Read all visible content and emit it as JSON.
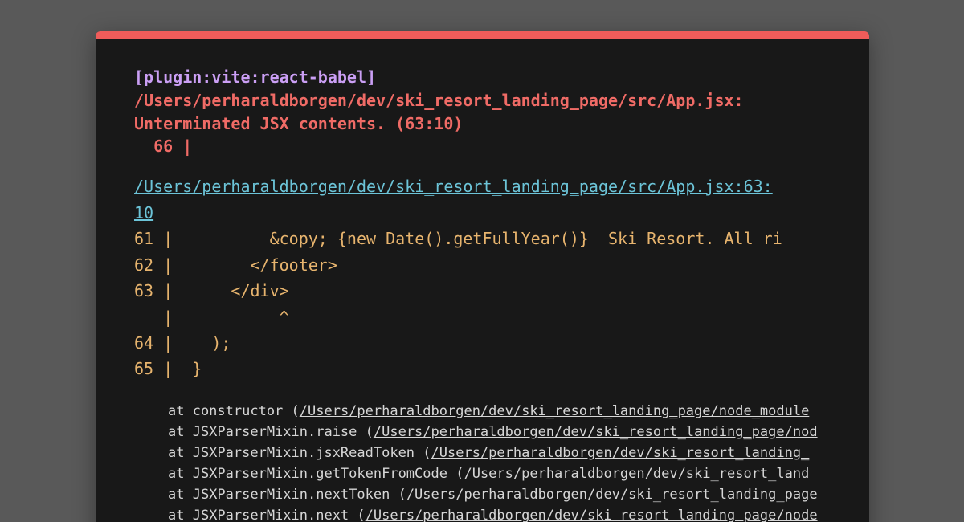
{
  "overlay": {
    "accent_color": "#f05c5a",
    "plugin": "[plugin:vite:react-babel]",
    "error_file": "/Users/perharaldborgen/dev/ski_resort_landing_page/src/App.jsx:",
    "error_message": "Unterminated JSX contents. (63:10)",
    "error_line_marker": "  66 |",
    "file_link_line1": "/Users/perharaldborgen/dev/ski_resort_landing_page/src/App.jsx:63:",
    "file_link_line2": "10",
    "code_frame": [
      "61 |          &copy; {new Date().getFullYear()}  Ski Resort. All ri",
      "62 |        </footer>",
      "63 |      </div>",
      "   |           ^",
      "64 |    );",
      "65 |  }"
    ],
    "stack": [
      {
        "prefix": "at constructor (",
        "url": "/Users/perharaldborgen/dev/ski_resort_landing_page/node_module"
      },
      {
        "prefix": "at JSXParserMixin.raise (",
        "url": "/Users/perharaldborgen/dev/ski_resort_landing_page/nod"
      },
      {
        "prefix": "at JSXParserMixin.jsxReadToken (",
        "url": "/Users/perharaldborgen/dev/ski_resort_landing_"
      },
      {
        "prefix": "at JSXParserMixin.getTokenFromCode (",
        "url": "/Users/perharaldborgen/dev/ski_resort_land"
      },
      {
        "prefix": "at JSXParserMixin.nextToken (",
        "url": "/Users/perharaldborgen/dev/ski_resort_landing_page"
      },
      {
        "prefix": "at JSXParserMixin.next (",
        "url": "/Users/perharaldborgen/dev/ski_resort_landing_page/node"
      }
    ]
  }
}
